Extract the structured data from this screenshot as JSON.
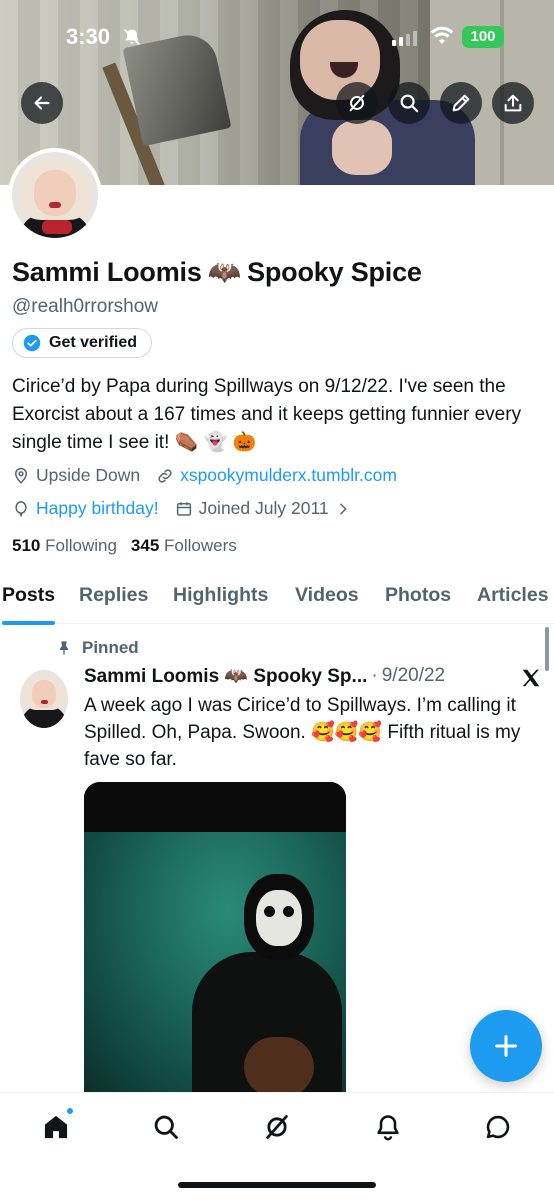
{
  "status_bar": {
    "time": "3:30",
    "battery": "100",
    "icons": [
      "bell-slash-icon",
      "signal-icon",
      "wifi-icon",
      "battery-icon"
    ]
  },
  "banner_buttons": {
    "icons": [
      "back-arrow-icon",
      "grok-icon",
      "search-icon",
      "edit-pencil-icon",
      "share-icon"
    ]
  },
  "profile": {
    "display_name": "Sammi Loomis",
    "name_emoji": "🦇",
    "name_suffix": "Spooky Spice",
    "handle": "@realh0rrorshow",
    "verify_label": "Get verified",
    "bio_line": "Cirice’d by Papa during Spillways on 9/12/22. I've seen the Exorcist about a 167 times and it keeps getting funnier every single time I see it! ⚰️ 👻 🎃",
    "location": "Upside Down",
    "website": "xspookymulderx.tumblr.com",
    "birthday": "Happy birthday!",
    "joined": "Joined July 2011",
    "following_count": "510",
    "following_label": "Following",
    "followers_count": "345",
    "followers_label": "Followers"
  },
  "tabs": [
    {
      "label": "Posts",
      "active": true
    },
    {
      "label": "Replies",
      "active": false
    },
    {
      "label": "Highlights",
      "active": false
    },
    {
      "label": "Videos",
      "active": false
    },
    {
      "label": "Photos",
      "active": false
    },
    {
      "label": "Articles",
      "active": false
    }
  ],
  "post": {
    "pinned_label": "Pinned",
    "author": "Sammi Loomis 🦇 Spooky Sp...",
    "separator": "·",
    "date": "9/20/22",
    "text": "A week ago I was Cirice’d to Spillways. I’m calling it Spilled. Oh, Papa. Swoon. 🥰🥰🥰 Fifth ritual is my fave so far."
  },
  "colors": {
    "accent": "#1d9bf0",
    "text_primary": "#0f1419",
    "text_secondary": "#536471",
    "battery_green": "#34c759"
  },
  "bottom_nav": {
    "icons": [
      "home-icon",
      "search-icon",
      "grok-icon",
      "notifications-bell-icon",
      "messages-icon"
    ]
  }
}
